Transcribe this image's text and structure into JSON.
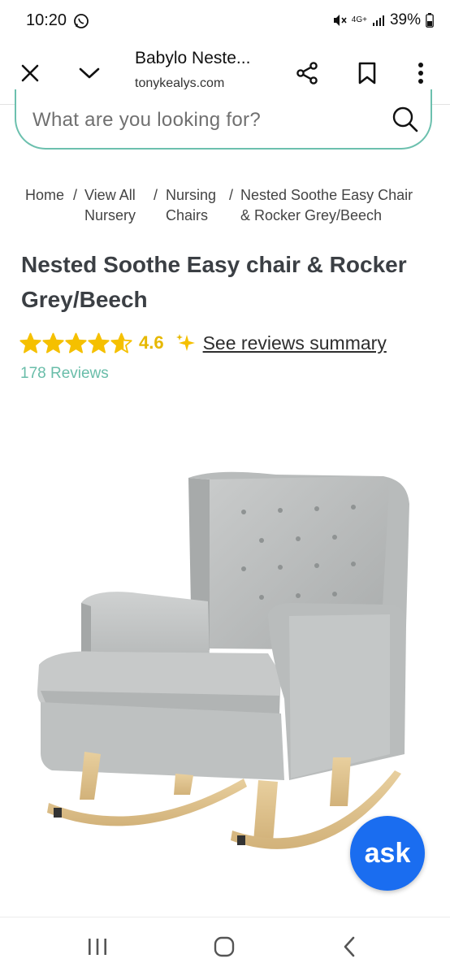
{
  "status_bar": {
    "time": "10:20",
    "battery": "39%",
    "network": "4G+"
  },
  "browser": {
    "title": "Babylo Neste...",
    "domain": "tonykealys.com"
  },
  "search": {
    "placeholder": "What are you looking for?"
  },
  "breadcrumb": {
    "home": "Home",
    "sep": "/",
    "view_all_1": "View All",
    "view_all_2": "Nursery",
    "nursing_1": "Nursing",
    "nursing_2": "Chairs",
    "current_1": "Nested Soothe Easy Chair",
    "current_2": "& Rocker Grey/Beech"
  },
  "product": {
    "title_line1": "Nested Soothe Easy chair & Rocker",
    "title_line2": "Grey/Beech",
    "rating": 4.6,
    "rating_text": "4.6",
    "reviews_link": "See reviews summary",
    "review_count": "178 Reviews"
  },
  "ask_button": {
    "label": "ask"
  },
  "colors": {
    "accent": "#6cc0ae",
    "star": "#f5c000",
    "ask": "#1a6df0",
    "title": "#3b3f44"
  },
  "icons": {
    "close": "close-icon",
    "collapse": "chevron-down-icon",
    "share": "share-icon",
    "bookmark": "bookmark-icon",
    "menu": "more-vert-icon",
    "search": "search-icon",
    "sparkle": "sparkle-icon",
    "nav_recents": "recents-icon",
    "nav_home": "home-icon",
    "nav_back": "back-icon"
  }
}
